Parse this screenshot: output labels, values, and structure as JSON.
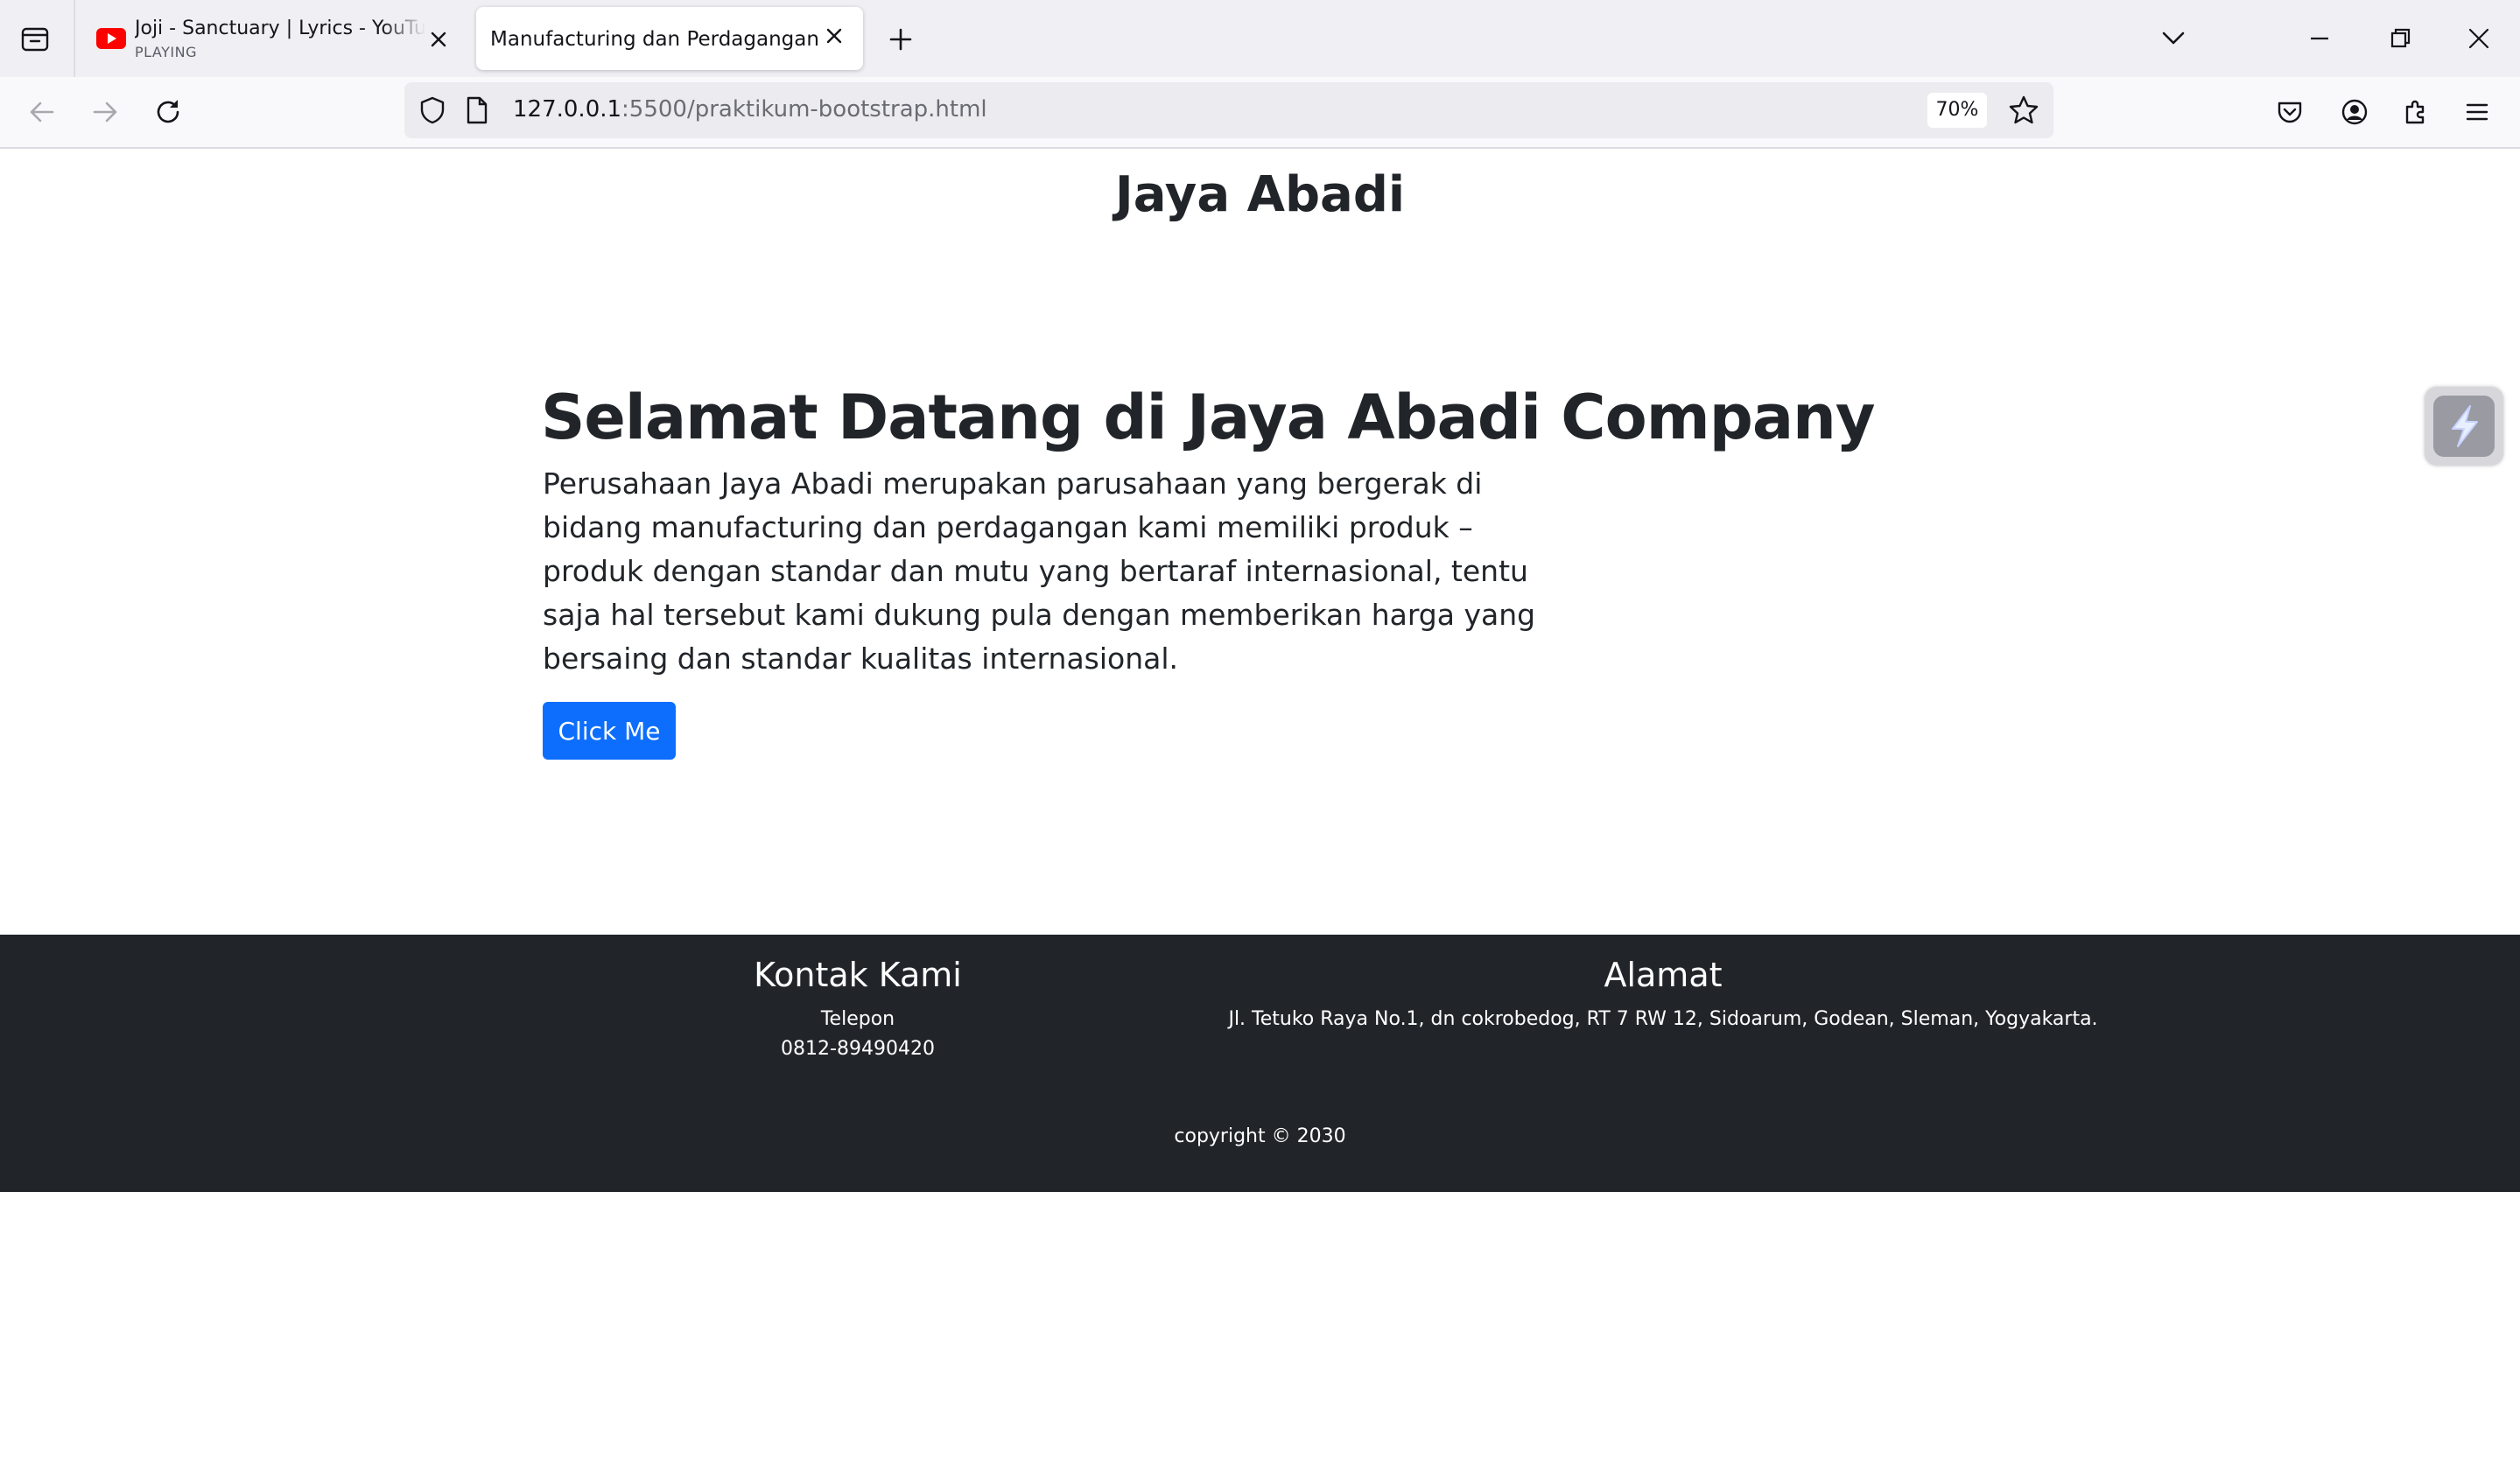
{
  "browser": {
    "tabs": [
      {
        "title": "Joji - Sanctuary | Lyrics - YouTube",
        "subtitle": "PLAYING",
        "active": false
      },
      {
        "title": "Manufacturing dan Perdagangan",
        "active": true
      }
    ],
    "url_host": "127.0.0.1",
    "url_rest": ":5500/praktikum-bootstrap.html",
    "zoom": "70%"
  },
  "page": {
    "brand": "Jaya Abadi",
    "hero_title": "Selamat Datang di Jaya Abadi Company",
    "hero_text": "Perusahaan Jaya Abadi merupakan parusahaan yang bergerak di bidang manufacturing dan perdagangan kami memiliki produk – produk dengan standar dan mutu yang bertaraf internasional, tentu saja hal tersebut kami dukung pula dengan memberikan harga yang bersaing dan standar kualitas internasional.",
    "button_label": "Click Me"
  },
  "footer": {
    "kontak_title": "Kontak Kami",
    "telepon_label": "Telepon",
    "telepon_number": "0812-89490420",
    "alamat_title": "Alamat",
    "alamat_text": "Jl. Tetuko Raya No.1, dn cokrobedog, RT 7 RW 12, Sidoarum, Godean, Sleman, Yogyakarta.",
    "copyright": "copyright © 2030"
  },
  "colors": {
    "primary": "#0d6efd",
    "footer_bg": "#212529",
    "text": "#212529"
  }
}
